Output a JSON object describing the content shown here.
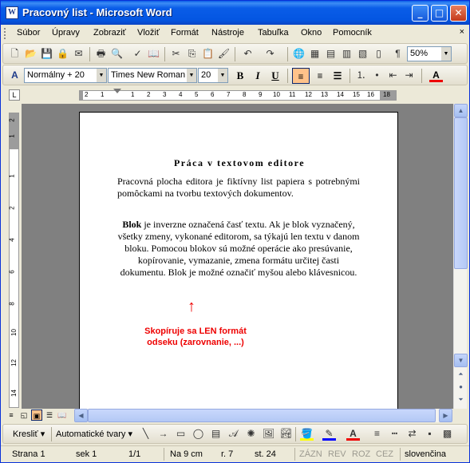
{
  "window": {
    "title": "Pracovný list - Microsoft Word",
    "app_icon": "W"
  },
  "title_buttons": {
    "minimize": "_",
    "maximize": "□",
    "close": "✕"
  },
  "menu": [
    "Súbor",
    "Úpravy",
    "Zobraziť",
    "Vložiť",
    "Formát",
    "Nástroje",
    "Tabuľka",
    "Okno",
    "Pomocník"
  ],
  "menu_close": "×",
  "standard_toolbar": {
    "zoom": "50%"
  },
  "formatting_toolbar": {
    "style": "Normálny + 20",
    "font": "Times New Roman",
    "size": "20",
    "bold": "B",
    "italic": "I",
    "underline": "U",
    "font_color_label": "A"
  },
  "ruler": {
    "corner": "L",
    "h_numbers": [
      "2",
      "1",
      "1",
      "2",
      "3",
      "4",
      "5",
      "6",
      "7",
      "8",
      "9",
      "10",
      "11",
      "12",
      "13",
      "14",
      "15",
      "16",
      "18"
    ],
    "v_numbers": [
      "2",
      "1",
      "1",
      "2",
      "4",
      "6",
      "8",
      "10",
      "12",
      "14",
      "16"
    ]
  },
  "document": {
    "heading": "Práca v textovom editore",
    "paragraph1": "Pracovná plocha editora je fiktívny list papiera s potrebnými pomôckami na tvorbu textových dokumentov.",
    "paragraph2_bold": "Blok",
    "paragraph2_rest": " je inverzne označená časť textu. Ak je blok vyznačený, všetky zmeny, vykonané editorom, sa týkajú len textu v danom bloku. Pomocou blokov sú možné operácie ako presúvanie, kopírovanie, vymazanie, zmena formátu určitej časti dokumentu. Blok je možné označiť myšou alebo klávesnicou.",
    "callout_line1": "Skopíruje sa LEN formát",
    "callout_line2": "odseku (zarovnanie, ...)"
  },
  "drawing_toolbar": {
    "draw": "Kresliť",
    "autoshapes": "Automatické tvary"
  },
  "status_bar": {
    "page": "Strana 1",
    "section": "sek 1",
    "pages": "1/1",
    "position": "Na 9 cm",
    "line": "r. 7",
    "column": "st. 24",
    "rec": "ZÁZN",
    "trk": "REV",
    "ext": "ROZ",
    "ovr": "CEZ",
    "language": "slovenčina"
  },
  "colors": {
    "accent_red": "#e00000",
    "title_blue": "#0A5DE8"
  }
}
